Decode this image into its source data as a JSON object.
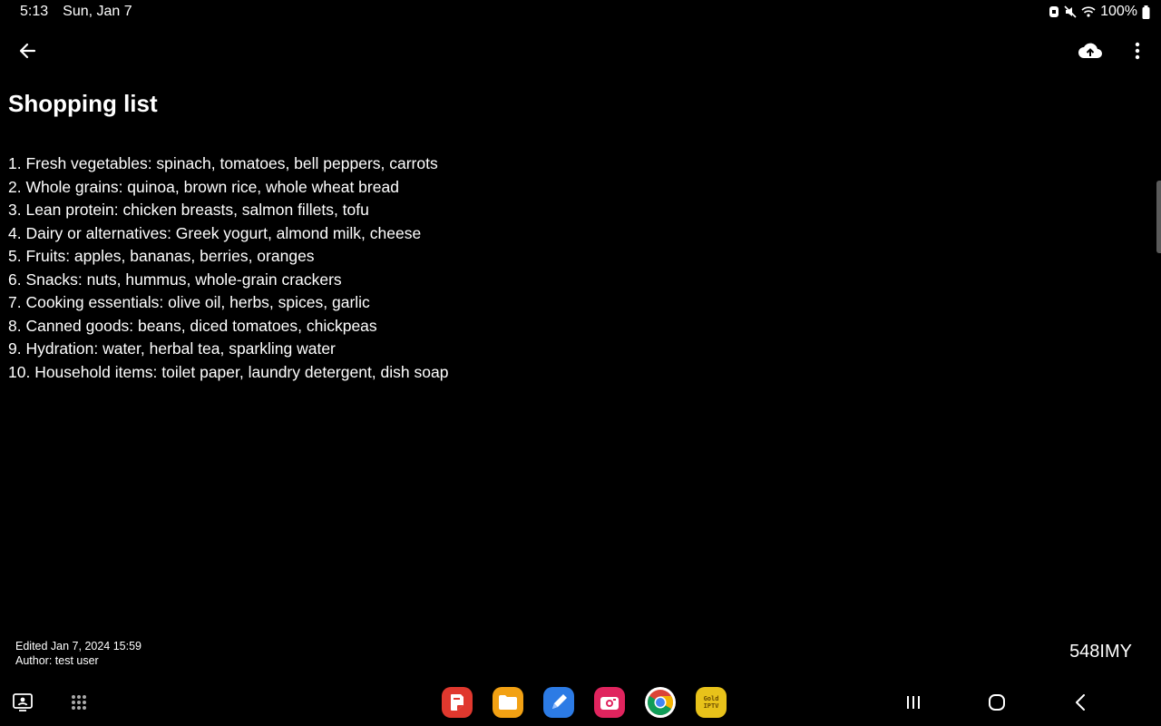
{
  "status_bar": {
    "time": "5:13",
    "date": "Sun, Jan 7",
    "battery": "100%"
  },
  "note": {
    "title": "Shopping list",
    "items": [
      "1. Fresh vegetables: spinach, tomatoes, bell peppers, carrots",
      "2. Whole grains: quinoa, brown rice, whole wheat bread",
      "3. Lean protein: chicken breasts, salmon fillets, tofu",
      "4. Dairy or alternatives: Greek yogurt, almond milk, cheese",
      "5. Fruits: apples, bananas, berries, oranges",
      "6. Snacks: nuts, hummus, whole-grain crackers",
      "7. Cooking essentials: olive oil, herbs, spices, garlic",
      "8. Canned goods: beans, diced tomatoes, chickpeas",
      "9. Hydration: water, herbal tea, sparkling water",
      "10. Household items: toilet paper, laundry detergent, dish soap"
    ],
    "edited": "Edited Jan 7, 2024  15:59",
    "author": "Author: test user",
    "code": "548IMY"
  },
  "app_bar": {
    "back_icon": "arrow-left-icon",
    "upload_icon": "cloud-upload-icon",
    "more_icon": "more-vert-icon"
  },
  "dock": {
    "apps": [
      {
        "name": "app-red",
        "color": "#e0382e"
      },
      {
        "name": "files",
        "color": "#f2a113"
      },
      {
        "name": "pen-app",
        "color": "#2c7be5"
      },
      {
        "name": "camera-app",
        "color": "#e0245e"
      },
      {
        "name": "chrome",
        "color": "#ffffff"
      },
      {
        "name": "gold-iptv",
        "color": "#e8c21a"
      }
    ],
    "iptv_label_1": "Gold",
    "iptv_label_2": "IPTV"
  },
  "colors": {
    "background": "#000000",
    "text": "#ffffff"
  }
}
